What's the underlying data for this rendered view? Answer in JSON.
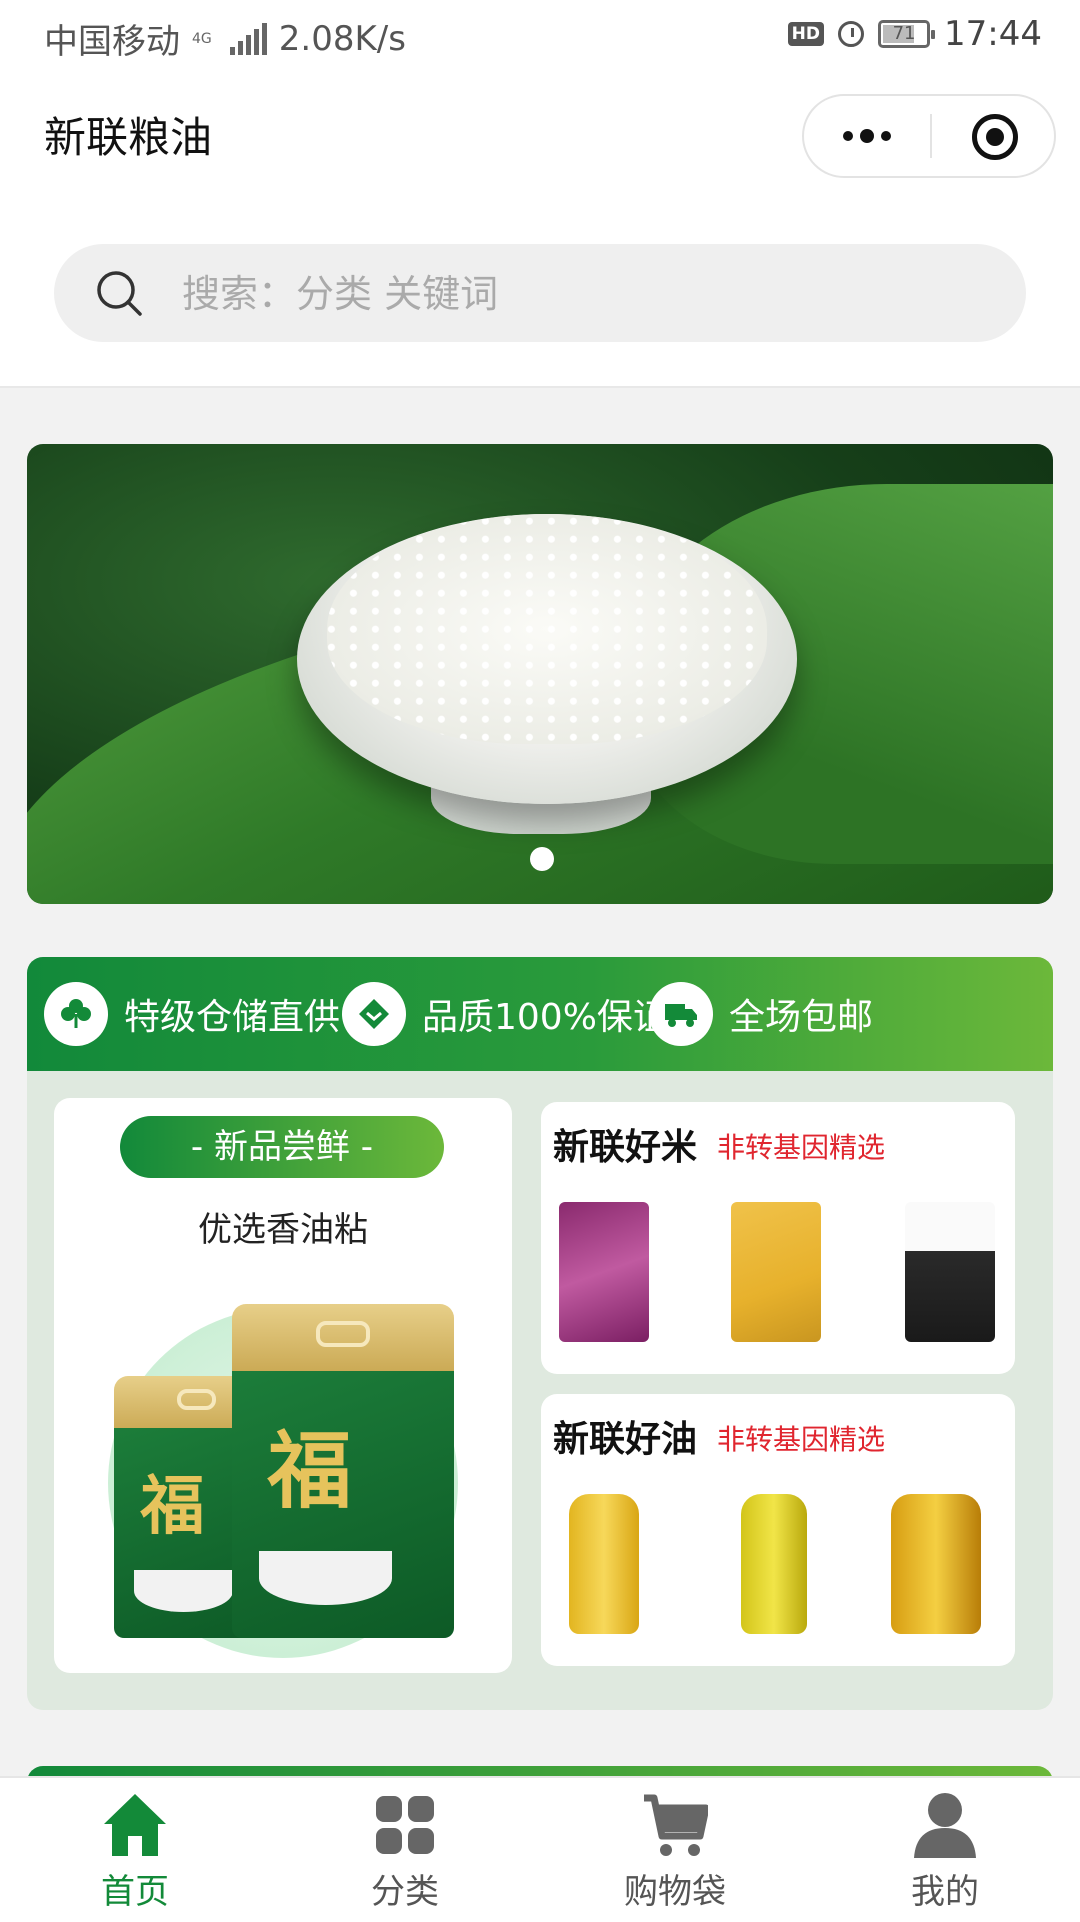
{
  "status_bar": {
    "carrier": "中国移动",
    "network": "4G",
    "speed": "2.08K/s",
    "hd": "HD",
    "battery": "71",
    "time": "17:44"
  },
  "header": {
    "title": "新联粮油"
  },
  "search": {
    "placeholder": "搜索：分类 关键词"
  },
  "banner": {
    "page_count": 1,
    "active_index": 0
  },
  "features": [
    {
      "label": "特级仓储直供",
      "icon": "clover-icon"
    },
    {
      "label": "品质100%保证",
      "icon": "diamond-icon"
    },
    {
      "label": "全场包邮",
      "icon": "truck-icon"
    }
  ],
  "promo_left": {
    "pill": "- 新品尝鲜 -",
    "title": "优选香油粘",
    "bag_brand": "福"
  },
  "promo_right": [
    {
      "title": "新联好米",
      "tag": "非转基因精选",
      "kind": "rice"
    },
    {
      "title": "新联好油",
      "tag": "非转基因精选",
      "kind": "oil"
    }
  ],
  "tabbar": {
    "items": [
      {
        "label": "首页",
        "icon": "home-icon",
        "active": true
      },
      {
        "label": "分类",
        "icon": "category-icon",
        "active": false
      },
      {
        "label": "购物袋",
        "icon": "cart-icon",
        "active": false
      },
      {
        "label": "我的",
        "icon": "user-icon",
        "active": false
      }
    ]
  },
  "colors": {
    "brand_green": "#138a39",
    "accent_light_green": "#6cb83a",
    "tag_red": "#e0262f"
  }
}
